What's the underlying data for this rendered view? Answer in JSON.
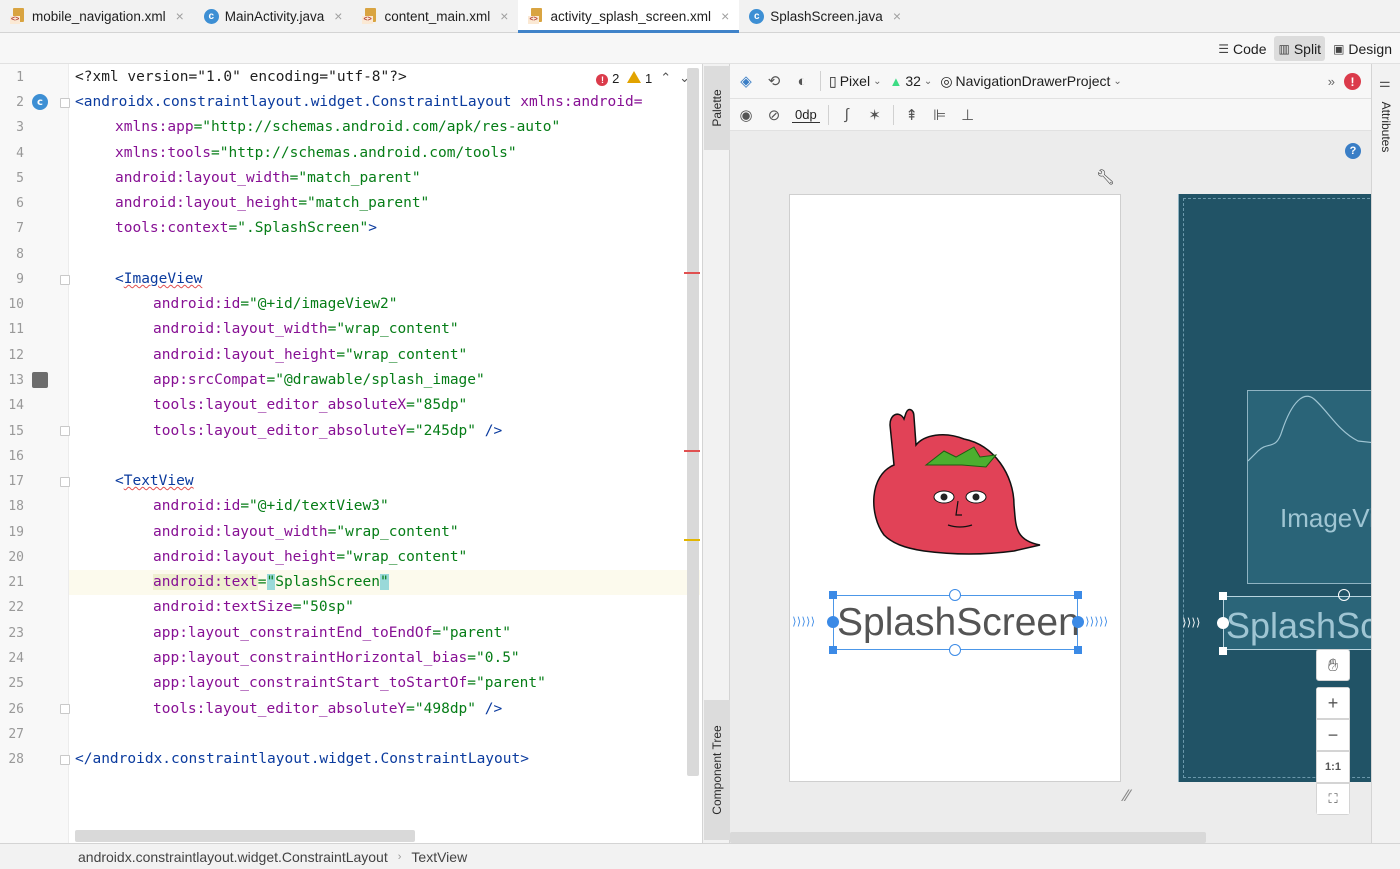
{
  "tabs": [
    {
      "label": "mobile_navigation.xml",
      "icon": "xml-file-icon",
      "active": false
    },
    {
      "label": "MainActivity.java",
      "icon": "java-class-icon",
      "active": false
    },
    {
      "label": "content_main.xml",
      "icon": "xml-file-icon",
      "active": false
    },
    {
      "label": "activity_splash_screen.xml",
      "icon": "xml-file-icon",
      "active": true
    },
    {
      "label": "SplashScreen.java",
      "icon": "java-class-icon",
      "active": false
    }
  ],
  "modes": {
    "code": "Code",
    "split": "Split",
    "design": "Design",
    "active": "split"
  },
  "inspections": {
    "errors": "2",
    "warnings": "1"
  },
  "code_lines": [
    "1",
    "2",
    "3",
    "4",
    "5",
    "6",
    "7",
    "8",
    "9",
    "10",
    "11",
    "12",
    "13",
    "14",
    "15",
    "16",
    "17",
    "18",
    "19",
    "20",
    "21",
    "22",
    "23",
    "24",
    "25",
    "26",
    "27",
    "28"
  ],
  "code": {
    "l1_a": "<?xml version=\"1.0\" encoding=\"utf-8\"?>",
    "l2_tag": "<androidx.constraintlayout.widget.ConstraintLayout",
    "l2_attr": "xmlns:android=",
    "l3": [
      "xmlns:app",
      "=\"http://schemas.android.com/apk/res-auto\""
    ],
    "l4": [
      "xmlns:tools",
      "=\"http://schemas.android.com/tools\""
    ],
    "l5": [
      "android:layout_width",
      "=\"match_parent\""
    ],
    "l6": [
      "android:layout_height",
      "=\"match_parent\""
    ],
    "l7": [
      "tools:context",
      "=\".SplashScreen\"",
      ">"
    ],
    "l9": [
      "<",
      "ImageView"
    ],
    "l10": [
      "android:id",
      "=\"@+id/imageView2\""
    ],
    "l11": [
      "android:layout_width",
      "=\"wrap_content\""
    ],
    "l12": [
      "android:layout_height",
      "=\"wrap_content\""
    ],
    "l13": [
      "app:srcCompat",
      "=\"@drawable/splash_image\""
    ],
    "l14": [
      "tools:layout_editor_absoluteX",
      "=\"85dp\""
    ],
    "l15": [
      "tools:layout_editor_absoluteY",
      "=\"245dp\"",
      " />"
    ],
    "l17": [
      "<",
      "TextView"
    ],
    "l18": [
      "android:id",
      "=\"@+id/textView3\""
    ],
    "l19": [
      "android:layout_width",
      "=\"wrap_content\""
    ],
    "l20": [
      "android:layout_height",
      "=\"wrap_content\""
    ],
    "l21": [
      "android:text",
      "=",
      "\"",
      "SplashScreen",
      "\""
    ],
    "l22": [
      "android:textSize",
      "=\"50sp\""
    ],
    "l23": [
      "app:layout_constraintEnd_toEndOf",
      "=\"parent\""
    ],
    "l24": [
      "app:layout_constraintHorizontal_bias",
      "=\"0.5\""
    ],
    "l25": [
      "app:layout_constraintStart_toStartOf",
      "=\"parent\""
    ],
    "l26": [
      "tools:layout_editor_absoluteY",
      "=\"498dp\"",
      " />"
    ],
    "l28": "</androidx.constraintlayout.widget.ConstraintLayout>"
  },
  "side_panels": {
    "palette": "Palette",
    "component_tree": "Component Tree",
    "attributes": "Attributes"
  },
  "design_toolbar": {
    "device": "Pixel",
    "api": "32",
    "theme": "NavigationDrawerProject",
    "margin": "0dp",
    "more": "»",
    "help": "?",
    "error": "!"
  },
  "preview": {
    "text": "SplashScreen",
    "blueprint_image_label": "ImageView",
    "blueprint_text_label": "SplashScreen"
  },
  "zoom": {
    "plus": "+",
    "minus": "−",
    "one_to_one": "1:1"
  },
  "breadcrumbs": [
    "androidx.constraintlayout.widget.ConstraintLayout",
    "TextView"
  ],
  "colors": {
    "accent": "#4083c9",
    "selection": "#3b8ae6",
    "blueprint": "#215366",
    "error": "#db3b4b",
    "warning": "#e2a300"
  }
}
